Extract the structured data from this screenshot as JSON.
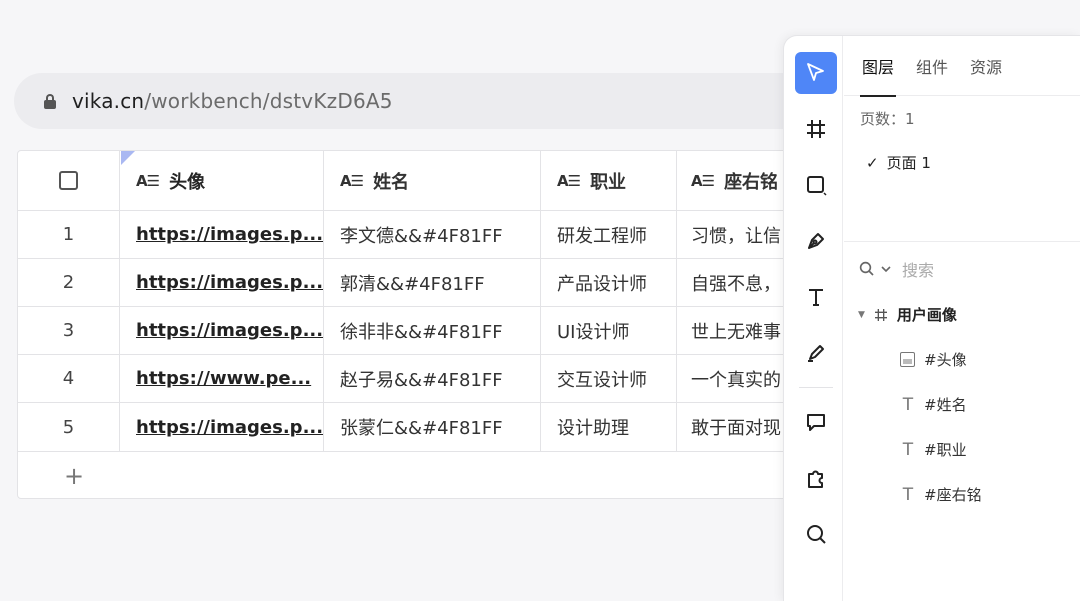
{
  "browser": {
    "url_domain": "vika.cn",
    "url_path": "/workbench/dstvKzD6A5"
  },
  "table": {
    "columns": [
      {
        "icon": "A☰",
        "label": "头像"
      },
      {
        "icon": "A☰",
        "label": "姓名"
      },
      {
        "icon": "A☰",
        "label": "职业"
      },
      {
        "icon": "A☰",
        "label": "座右铭"
      }
    ],
    "rows": [
      {
        "num": "1",
        "avatar": "https://images.p...",
        "name": "李文德&&#4F81FF",
        "job": "研发工程师",
        "motto": "习惯，让信"
      },
      {
        "num": "2",
        "avatar": "https://images.p...",
        "name": "郭清&&#4F81FF",
        "job": "产品设计师",
        "motto": "自强不息，"
      },
      {
        "num": "3",
        "avatar": "https://images.p...",
        "name": "徐非非&&#4F81FF",
        "job": "UI设计师",
        "motto": "世上无难事"
      },
      {
        "num": "4",
        "avatar": "https://www.pe...",
        "name": "赵子易&&#4F81FF",
        "job": "交互设计师",
        "motto": "一个真实的"
      },
      {
        "num": "5",
        "avatar": "https://images.p...",
        "name": "张蒙仁&&#4F81FF",
        "job": "设计助理",
        "motto": "敢于面对现"
      }
    ],
    "add_label": "+"
  },
  "panel": {
    "tabs": [
      "图层",
      "组件",
      "资源"
    ],
    "pages_label": "页数：1",
    "page_item": "页面 1",
    "search_placeholder": "搜索",
    "frame_name": "用户画像",
    "layers": [
      {
        "icon": "image-icon",
        "name": "#头像"
      },
      {
        "icon": "text-icon",
        "name": "#姓名"
      },
      {
        "icon": "text-icon",
        "name": "#职业"
      },
      {
        "icon": "text-icon",
        "name": "#座右铭"
      }
    ],
    "accent_color": "#4F86F7"
  }
}
